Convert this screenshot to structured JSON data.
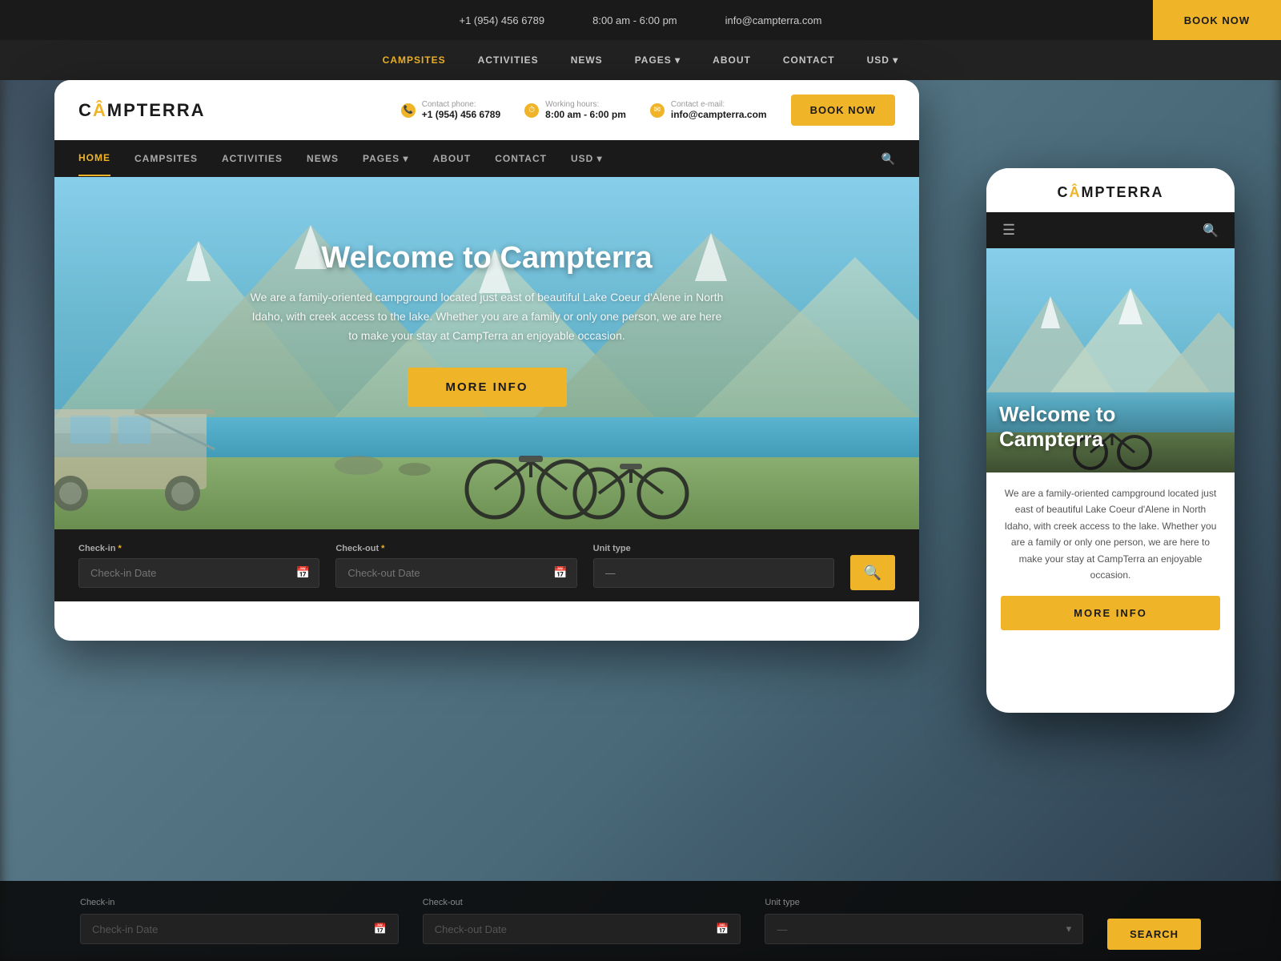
{
  "brand": {
    "name": "CAMPTERRA",
    "logo_dot_char": "Â",
    "tagline": "Welcome to Campterra"
  },
  "topbar": {
    "phone_label": "Contact phone:",
    "phone_value": "+1 (954) 456 6789",
    "hours_label": "Working hours:",
    "hours_value": "8:00 am - 6:00 pm",
    "email_label": "Contact e-mail:",
    "email_value": "info@campterra.com"
  },
  "nav": {
    "items": [
      {
        "label": "HOME",
        "active": true
      },
      {
        "label": "CAMPSITES",
        "active": false
      },
      {
        "label": "ACTIVITIES",
        "active": false
      },
      {
        "label": "NEWS",
        "active": false
      },
      {
        "label": "PAGES ▾",
        "active": false
      },
      {
        "label": "ABOUT",
        "active": false
      },
      {
        "label": "CONTACT",
        "active": false
      },
      {
        "label": "USD ▾",
        "active": false
      }
    ]
  },
  "hero": {
    "title": "Welcome to Campterra",
    "description": "We are a family-oriented campground located just east of beautiful Lake Coeur d'Alene in North Idaho, with creek access to the lake. Whether you are a family or only one person, we are here to make your stay at CampTerra an enjoyable occasion.",
    "cta_label": "MORE INFO"
  },
  "booking": {
    "checkin_label": "Check-in",
    "checkin_required": true,
    "checkin_placeholder": "Check-in Date",
    "checkout_label": "Check-out",
    "checkout_required": true,
    "checkout_placeholder": "Check-out Date",
    "unit_label": "Unit type",
    "unit_placeholder": "—",
    "search_label": "SEARCH"
  },
  "book_now_label": "BOOK NOW",
  "mobile": {
    "title": "Welcome to Campterra",
    "description": "We are a family-oriented campground located just east of beautiful Lake Coeur d'Alene in North Idaho, with creek access to the lake. Whether you are a family or only one person, we are here to make your stay at CampTerra an enjoyable occasion.",
    "cta_label": "MORE INFO"
  },
  "colors": {
    "accent": "#f0b429",
    "dark": "#1a1a1a",
    "white": "#ffffff"
  }
}
